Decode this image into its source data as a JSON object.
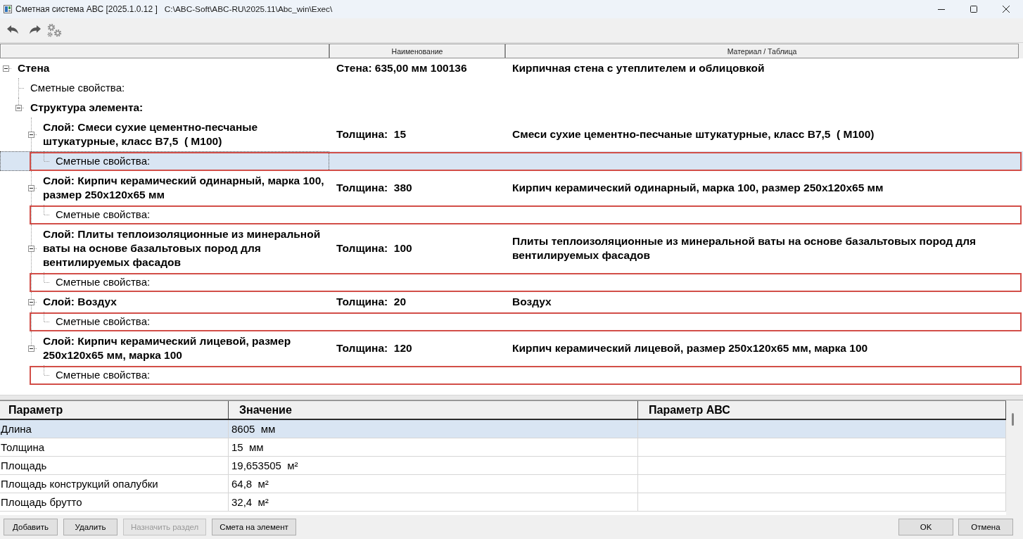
{
  "window": {
    "title": "Сметная система АВС [2025.1.0.12 ]",
    "path": "C:\\ABC-Soft\\ABC-RU\\2025.11\\Abc_win\\Exec\\"
  },
  "tree": {
    "columns": [
      "Наименование",
      "Материал / Таблица"
    ],
    "nodes": [
      {
        "kind": "element",
        "label": "Стена",
        "name": "Стена: 635,00 мм 100136",
        "material": "Кирпичная стена с утеплителем и облицовкой",
        "expanded": true,
        "selected": false,
        "highlighted": false,
        "children": [
          {
            "kind": "properties",
            "label": "Сметные свойства:",
            "selected": false,
            "highlighted": false
          },
          {
            "kind": "group",
            "label": "Структура элемента:",
            "expanded": true,
            "selected": false,
            "highlighted": false,
            "children": [
              {
                "kind": "layer",
                "label": "Слой: Смеси сухие цементно-песчаные штукатурные, класс В7,5  ( М100)",
                "name": "Толщина:  15",
                "material": "Смеси сухие цементно-песчаные штукатурные, класс В7,5  ( М100)",
                "expanded": true,
                "selected": false,
                "highlighted": false,
                "children": [
                  {
                    "kind": "properties",
                    "label": "Сметные свойства:",
                    "selected": true,
                    "highlighted": true
                  }
                ]
              },
              {
                "kind": "layer",
                "label": "Слой: Кирпич керамический одинарный, марка 100, размер 250х120х65 мм",
                "name": "Толщина:  380",
                "material": "Кирпич керамический одинарный, марка 100, размер 250х120х65 мм",
                "expanded": true,
                "selected": false,
                "highlighted": false,
                "children": [
                  {
                    "kind": "properties",
                    "label": "Сметные свойства:",
                    "selected": false,
                    "highlighted": true
                  }
                ]
              },
              {
                "kind": "layer",
                "label": "Слой: Плиты теплоизоляционные из минеральной ваты на основе базальтовых пород для вентилируемых фасадов",
                "name": "Толщина:  100",
                "material": "Плиты теплоизоляционные из минеральной ваты на основе базальтовых пород для вентилируемых фасадов",
                "expanded": true,
                "selected": false,
                "highlighted": false,
                "children": [
                  {
                    "kind": "properties",
                    "label": "Сметные свойства:",
                    "selected": false,
                    "highlighted": true
                  }
                ]
              },
              {
                "kind": "layer",
                "label": "Слой: Воздух",
                "name": "Толщина:  20",
                "material": "Воздух",
                "expanded": true,
                "selected": false,
                "highlighted": false,
                "children": [
                  {
                    "kind": "properties",
                    "label": "Сметные свойства:",
                    "selected": false,
                    "highlighted": true
                  }
                ]
              },
              {
                "kind": "layer",
                "label": "Слой: Кирпич керамический лицевой, размер 250х120х65 мм, марка 100",
                "name": "Толщина:  120",
                "material": "Кирпич керамический лицевой, размер 250х120х65 мм, марка 100",
                "expanded": true,
                "selected": false,
                "highlighted": false,
                "children": [
                  {
                    "kind": "properties",
                    "label": "Сметные свойства:",
                    "selected": false,
                    "highlighted": true
                  }
                ]
              }
            ]
          }
        ]
      }
    ]
  },
  "parameters": {
    "columns": [
      "Параметр",
      "Значение",
      "Параметр АВС"
    ],
    "rows": [
      {
        "parameter": "Длина",
        "value": "8605  мм",
        "selected": true
      },
      {
        "parameter": "Толщина",
        "value": "15  мм",
        "selected": false
      },
      {
        "parameter": "Площадь",
        "value": "19,653505  м²",
        "selected": false
      },
      {
        "parameter": "Площадь конструкций опалубки",
        "value": "64,8  м²",
        "selected": false
      },
      {
        "parameter": "Площадь брутто",
        "value": "32,4  м²",
        "selected": false
      }
    ]
  },
  "actions": [
    {
      "label": "Добавить",
      "disabled": false
    },
    {
      "label": "Удалить",
      "disabled": false
    },
    {
      "label": "Назначить раздел",
      "disabled": true
    },
    {
      "label": "Смета на элемент",
      "disabled": false
    }
  ],
  "dialog_buttons": [
    "OK",
    "Отмена"
  ]
}
